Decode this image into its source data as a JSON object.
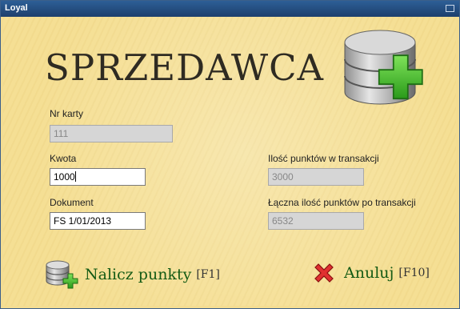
{
  "window": {
    "title": "Loyal"
  },
  "heading": "SPRZEDAWCA",
  "fields": {
    "card_number": {
      "label": "Nr karty",
      "value": "111"
    },
    "amount": {
      "label": "Kwota",
      "value": "1000"
    },
    "document": {
      "label": "Dokument",
      "value": "FS 1/01/2013"
    },
    "points_in_transaction": {
      "label": "Ilość punktów w transakcji",
      "value": "3000"
    },
    "total_points": {
      "label": "Łączna ilość punktów po transakcji",
      "value": "6532"
    }
  },
  "actions": {
    "accrue": {
      "label": "Nalicz punkty",
      "shortcut": "[F1]"
    },
    "cancel": {
      "label": "Anuluj",
      "shortcut": "[F10]"
    }
  },
  "colors": {
    "background": "#f5df94",
    "titlebar": "#1d3f6d",
    "accent_green": "#145a14",
    "cancel_red": "#d22"
  }
}
